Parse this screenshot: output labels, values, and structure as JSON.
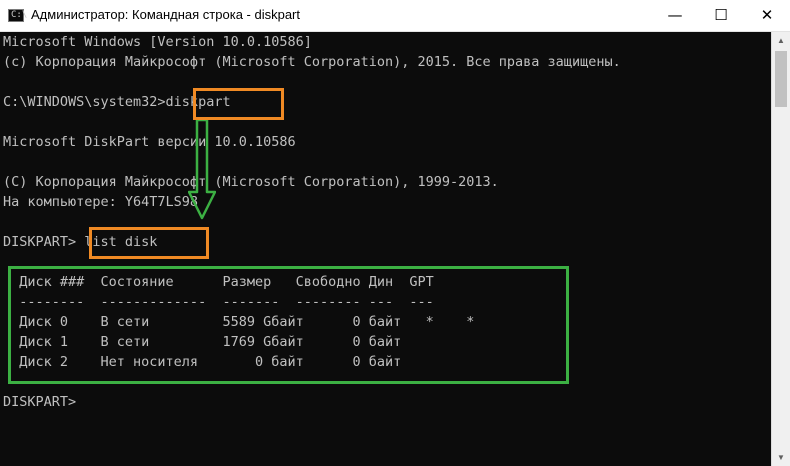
{
  "window": {
    "title": "Администратор: Командная строка - diskpart",
    "app_icon_glyph": "C:\\",
    "app_icon": "cmd-icon",
    "controls": {
      "minimize": "—",
      "maximize": "☐",
      "close": "✕"
    }
  },
  "console": {
    "lines": [
      "Microsoft Windows [Version 10.0.10586]",
      "(c) Корпорация Майкрософт (Microsoft Corporation), 2015. Все права защищены.",
      "",
      "C:\\WINDOWS\\system32>diskpart",
      "",
      "Microsoft DiskPart версии 10.0.10586",
      "",
      "(C) Корпорация Майкрософт (Microsoft Corporation), 1999-2013.",
      "На компьютере: Y64T7LS98",
      "",
      "DISKPART> list disk",
      "",
      "  Диск ###  Состояние      Размер   Свободно Дин  GPT",
      "  --------  -------------  -------  -------- ---  ---",
      "  Диск 0    В сети         5589 Gбайт      0 байт   *    *",
      "  Диск 1    В сети         1769 Gбайт      0 байт",
      "  Диск 2    Нет носителя       0 байт      0 байт",
      "",
      "DISKPART>"
    ]
  },
  "colors": {
    "console_background": "#0c0c0c",
    "console_text": "#c0c0c0",
    "highlight_orange": "#f08a24",
    "highlight_green": "#3cb043"
  },
  "scrollbar": {
    "up_arrow": "▲",
    "down_arrow": "▼"
  }
}
